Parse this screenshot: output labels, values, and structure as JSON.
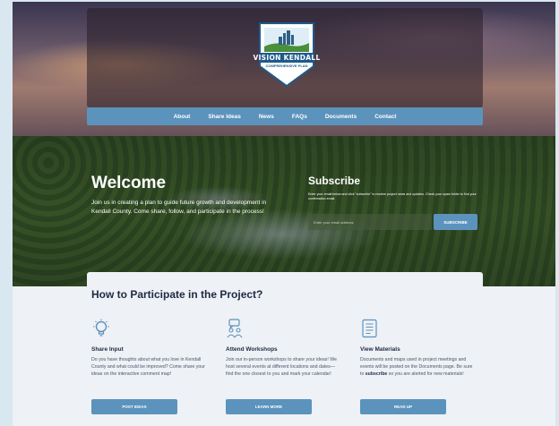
{
  "header": {
    "logo_title": "VISION KENDALL",
    "logo_subtitle": "COMPREHENSIVE PLAN"
  },
  "nav": {
    "items": [
      "About",
      "Share Ideas",
      "News",
      "FAQs",
      "Documents",
      "Contact"
    ]
  },
  "welcome": {
    "title": "Welcome",
    "text": "Join us in creating a plan to guide future growth and development in Kendall County. Come share, follow, and participate in the process!"
  },
  "subscribe": {
    "title": "Subscribe",
    "text": "Enter your email below and click \"subscribe\" to receive project news and updates. Check your spam folder to find your confirmation email.",
    "placeholder": "Enter your email address",
    "button": "SUBSCRIBE"
  },
  "participate": {
    "title": "How to Participate in the Project?",
    "columns": [
      {
        "icon": "lightbulb-icon",
        "title": "Share Input",
        "text": "Do you have thoughts about what you love in Kendall County and what could be improved? Come share your ideas on the interactive comment map!",
        "button": "POST IDEAS"
      },
      {
        "icon": "group-chat-icon",
        "title": "Attend Workshops",
        "text": "Join our in-person workshops to share your ideas! We host several events at different locations and dates—find the one closest to you and mark your calendar!",
        "button": "LEARN MORE"
      },
      {
        "icon": "document-icon",
        "title": "View Materials",
        "text_before": "Documents and maps used in project meetings and events will be posted on the Documents page. Be sure to ",
        "text_bold": "subscribe",
        "text_after": " so you are alerted for new materials!",
        "button": "READ UP"
      }
    ]
  },
  "colors": {
    "accent": "#5b93bd",
    "heading": "#1e2a44",
    "background": "#eef1f5"
  }
}
